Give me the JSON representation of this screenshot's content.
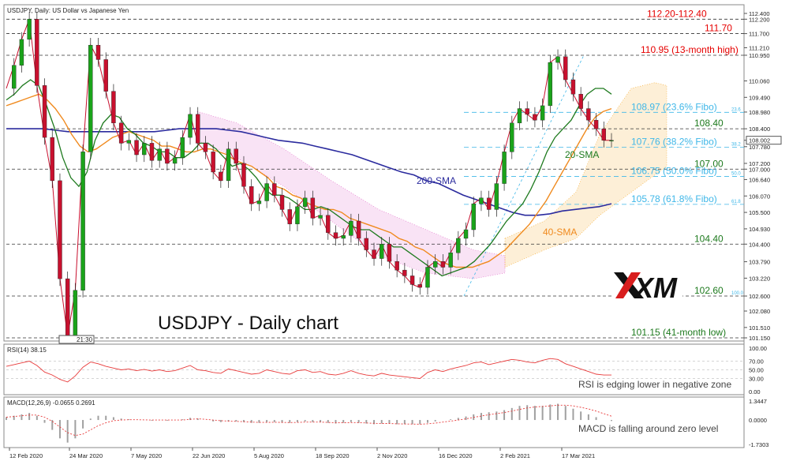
{
  "chart_data": {
    "type": "line",
    "title": "USDJPY - Daily chart",
    "header": "USDJPY, Daily:  US Dollar vs Japanese Yen",
    "brand": "XM",
    "colors": {
      "sma20": "#1e7a1e",
      "sma40": "#f08a1e",
      "sma200": "#2b2b9e",
      "price": "#c8102e",
      "tenkan": "#d05050",
      "kijun": "#5050d8",
      "chikou": "#33cc33",
      "cloud_bull": "#f5a623",
      "cloud_bear": "#e066c6",
      "fibo": "#3fb7e8",
      "level_red": "#e60000",
      "level_green": "#1e7a1e",
      "rsi": "#e83a3a",
      "macd_signal": "#e83a3a",
      "macd_hist": "#a0a0a0"
    },
    "price_axis": {
      "ylim": [
        101.15,
        112.4
      ],
      "ticks": [
        "112.400",
        "112.200",
        "111.700",
        "111.210",
        "110.950",
        "110.060",
        "109.490",
        "108.980",
        "108.400",
        "108.002",
        "107.780",
        "107.200",
        "107.000",
        "106.640",
        "106.070",
        "105.500",
        "104.930",
        "104.400",
        "103.790",
        "103.220",
        "102.600",
        "102.080",
        "101.510",
        "101.150"
      ]
    },
    "x_ticks": [
      "12 Feb 2020",
      "24 Mar 2020",
      "7 May 2020",
      "22 Jun 2020",
      "5 Aug 2020",
      "18 Sep 2020",
      "2 Nov 2020",
      "16 Dec 2020",
      "2 Feb 2021",
      "17 Mar 2021"
    ],
    "series": [
      {
        "name": "price",
        "x": [
          0,
          5,
          10,
          15,
          20,
          25,
          30,
          35,
          40,
          45,
          50,
          55,
          60,
          65,
          70,
          75,
          80,
          85,
          90,
          95,
          100,
          105,
          110,
          115,
          120,
          125,
          130,
          135,
          140,
          145,
          150,
          155,
          160,
          165,
          170,
          175,
          180,
          185,
          190,
          195,
          200,
          205,
          210,
          215,
          220,
          225,
          230,
          235,
          240,
          245,
          250,
          255,
          260,
          265,
          270,
          275,
          280,
          285,
          290,
          295,
          300,
          305,
          310,
          315,
          320,
          325,
          330,
          335,
          340,
          345,
          350,
          355,
          360,
          365,
          370,
          375,
          380,
          385,
          390,
          395,
          400,
          405,
          410,
          415,
          420,
          425,
          430
        ],
        "values": [
          109.8,
          110.6,
          111.5,
          112.2,
          109.9,
          108.1,
          106.6,
          103.2,
          101.2,
          102.8,
          107.6,
          111.3,
          110.8,
          109.7,
          108.6,
          107.9,
          108.0,
          107.5,
          107.9,
          107.3,
          107.7,
          107.2,
          107.4,
          108.1,
          108.9,
          107.9,
          107.6,
          106.9,
          106.6,
          107.7,
          107.2,
          106.4,
          105.8,
          105.9,
          106.5,
          106.1,
          105.6,
          105.1,
          105.7,
          106.0,
          105.3,
          105.4,
          104.8,
          104.6,
          104.7,
          105.2,
          104.6,
          104.2,
          103.9,
          104.4,
          103.8,
          103.5,
          103.3,
          103.0,
          102.9,
          103.6,
          103.8,
          103.6,
          104.1,
          104.6,
          104.9,
          105.8,
          106.0,
          105.6,
          106.5,
          107.6,
          108.6,
          109.1,
          108.9,
          108.7,
          109.2,
          110.7,
          110.9,
          110.1,
          109.6,
          109.1,
          108.7,
          108.4,
          108.0,
          108.0,
          108.0,
          108.0,
          108.0,
          108.0,
          108.0,
          108.0,
          108.0
        ]
      },
      {
        "name": "20-SMA",
        "values": [
          109.4,
          109.6,
          109.9,
          110.1,
          109.9,
          109.2,
          108.4,
          107.4,
          106.7,
          106.4,
          106.9,
          108.0,
          108.6,
          108.9,
          108.8,
          108.4,
          108.2,
          107.9,
          107.8,
          107.6,
          107.6,
          107.4,
          107.4,
          107.6,
          107.9,
          107.9,
          107.7,
          107.4,
          107.1,
          107.2,
          107.0,
          106.7,
          106.3,
          106.1,
          106.1,
          106.0,
          105.8,
          105.6,
          105.6,
          105.7,
          105.6,
          105.4,
          105.2,
          105.0,
          104.9,
          104.9,
          104.7,
          104.5,
          104.3,
          104.3,
          104.1,
          103.9,
          103.7,
          103.5,
          103.3,
          103.4,
          103.5,
          103.6,
          103.8,
          104.1,
          104.4,
          104.8,
          105.2,
          105.5,
          105.8,
          106.3,
          106.9,
          107.6,
          108.1,
          108.4,
          108.7,
          109.2,
          109.6,
          109.8,
          109.8,
          109.6
        ]
      },
      {
        "name": "40-SMA",
        "values": [
          109.2,
          109.3,
          109.4,
          109.5,
          109.6,
          109.4,
          109.1,
          108.7,
          108.2,
          107.8,
          107.6,
          107.7,
          107.9,
          108.1,
          108.2,
          108.3,
          108.2,
          108.1,
          108.0,
          107.8,
          107.8,
          107.7,
          107.6,
          107.6,
          107.7,
          107.7,
          107.6,
          107.5,
          107.3,
          107.2,
          107.1,
          106.9,
          106.7,
          106.4,
          106.3,
          106.1,
          106.0,
          105.8,
          105.7,
          105.6,
          105.6,
          105.5,
          105.3,
          105.2,
          105.1,
          105.0,
          104.9,
          104.8,
          104.6,
          104.5,
          104.3,
          104.2,
          104.0,
          103.8,
          103.7,
          103.6,
          103.6,
          103.6,
          103.7,
          103.8,
          104.0,
          104.2,
          104.5,
          104.8,
          105.1,
          105.5,
          105.9,
          106.4,
          106.9,
          107.4,
          107.9,
          108.4,
          108.8,
          109.0,
          109.1
        ]
      },
      {
        "name": "200-SMA",
        "values": [
          108.4,
          108.4,
          108.4,
          108.4,
          108.35,
          108.3,
          108.3,
          108.3,
          108.3,
          108.3,
          108.3,
          108.3,
          108.3,
          108.35,
          108.4,
          108.4,
          108.4,
          108.4,
          108.35,
          108.3,
          108.2,
          108.1,
          108.0,
          107.95,
          107.9,
          107.8,
          107.7,
          107.6,
          107.5,
          107.35,
          107.2,
          107.05,
          106.9,
          106.8,
          106.6,
          106.5,
          106.3,
          106.1,
          105.95,
          105.8,
          105.65,
          105.5,
          105.4,
          105.4,
          105.45,
          105.55,
          105.6,
          105.65,
          105.7,
          105.8
        ]
      }
    ],
    "levels": [
      {
        "value": 112.2,
        "label": "112.20-112.40",
        "color": "red"
      },
      {
        "value": 111.7,
        "label": "111.70",
        "color": "red"
      },
      {
        "value": 110.95,
        "label": "110.95 (13-month high)",
        "color": "red"
      },
      {
        "value": 108.97,
        "label": "108.97 (23.6% Fibo)",
        "color": "fibo"
      },
      {
        "value": 108.4,
        "label": "108.40",
        "color": "green"
      },
      {
        "value": 107.76,
        "label": "107.76 (38.2% Fibo)",
        "color": "fibo"
      },
      {
        "value": 107.0,
        "label": "107.00",
        "color": "green"
      },
      {
        "value": 106.75,
        "label": "106.75 (50.0% Fibo)",
        "color": "fibo"
      },
      {
        "value": 105.78,
        "label": "105.78 (61.8% Fibo)",
        "color": "fibo"
      },
      {
        "value": 104.4,
        "label": "104.40",
        "color": "green"
      },
      {
        "value": 102.6,
        "label": "102.60",
        "color": "green"
      },
      {
        "value": 101.15,
        "label": "101.15 (41-month low)",
        "color": "green"
      }
    ],
    "fibo_markers": [
      "23.6",
      "38.2",
      "50.0",
      "61.8",
      "100.0"
    ],
    "annotations": [
      {
        "text": "200-SMA",
        "color": "sma200"
      },
      {
        "text": "20-SMA",
        "color": "sma20"
      },
      {
        "text": "40-SMA",
        "color": "sma40"
      }
    ],
    "misc_label": "21:30",
    "rsi": {
      "label": "RSI(14) 38.15",
      "ylim": [
        0,
        100
      ],
      "ticks": [
        "100.00",
        "70.00",
        "50.00",
        "30.00",
        "0.00"
      ],
      "note": "RSI is edging lower in negative zone",
      "values": [
        58,
        62,
        66,
        70,
        60,
        45,
        38,
        28,
        22,
        36,
        56,
        68,
        64,
        58,
        54,
        50,
        52,
        48,
        51,
        47,
        50,
        46,
        48,
        54,
        60,
        50,
        48,
        44,
        42,
        52,
        48,
        44,
        40,
        42,
        50,
        46,
        42,
        40,
        48,
        50,
        44,
        46,
        40,
        38,
        42,
        48,
        42,
        38,
        36,
        42,
        38,
        36,
        34,
        32,
        30,
        44,
        50,
        46,
        52,
        56,
        60,
        66,
        68,
        62,
        66,
        70,
        74,
        72,
        68,
        66,
        72,
        76,
        74,
        64,
        58,
        52,
        46,
        40,
        38,
        38
      ]
    },
    "macd": {
      "label": "MACD(12,26,9) -0.0655 0.2691",
      "ylim": [
        -1.7303,
        1.3447
      ],
      "ticks": [
        "1.3447",
        "0.0000",
        "-1.7303"
      ],
      "note": "MACD is falling around zero level",
      "hist": [
        0.2,
        0.3,
        0.4,
        0.5,
        0.3,
        -0.2,
        -0.7,
        -1.3,
        -1.6,
        -1.3,
        -0.6,
        0.1,
        0.3,
        0.3,
        0.2,
        0.1,
        0.05,
        0.0,
        0.0,
        -0.05,
        0.0,
        -0.05,
        0.0,
        0.05,
        0.15,
        0.1,
        0.0,
        -0.1,
        -0.15,
        -0.1,
        -0.1,
        -0.15,
        -0.2,
        -0.2,
        -0.15,
        -0.15,
        -0.2,
        -0.2,
        -0.15,
        -0.1,
        -0.15,
        -0.15,
        -0.2,
        -0.25,
        -0.2,
        -0.15,
        -0.2,
        -0.25,
        -0.3,
        -0.25,
        -0.25,
        -0.3,
        -0.3,
        -0.3,
        -0.3,
        -0.2,
        -0.1,
        0.0,
        0.05,
        0.15,
        0.25,
        0.4,
        0.5,
        0.55,
        0.6,
        0.7,
        0.85,
        1.0,
        1.05,
        1.0,
        1.0,
        1.1,
        1.15,
        1.0,
        0.8,
        0.6,
        0.4,
        0.2,
        0.0,
        -0.07
      ],
      "signal": [
        0.2,
        0.25,
        0.3,
        0.35,
        0.35,
        0.2,
        -0.1,
        -0.5,
        -0.9,
        -1.1,
        -1.0,
        -0.7,
        -0.4,
        -0.2,
        -0.05,
        0.0,
        0.02,
        0.02,
        0.01,
        0.0,
        0.0,
        0.0,
        0.0,
        0.0,
        0.05,
        0.08,
        0.05,
        0.0,
        -0.05,
        -0.08,
        -0.1,
        -0.12,
        -0.15,
        -0.17,
        -0.17,
        -0.16,
        -0.17,
        -0.18,
        -0.17,
        -0.15,
        -0.15,
        -0.15,
        -0.17,
        -0.2,
        -0.2,
        -0.18,
        -0.19,
        -0.21,
        -0.24,
        -0.25,
        -0.25,
        -0.27,
        -0.28,
        -0.29,
        -0.3,
        -0.27,
        -0.22,
        -0.15,
        -0.08,
        0.0,
        0.08,
        0.18,
        0.28,
        0.37,
        0.45,
        0.53,
        0.63,
        0.75,
        0.85,
        0.92,
        0.96,
        1.0,
        1.05,
        1.05,
        1.0,
        0.9,
        0.78,
        0.63,
        0.45,
        0.27
      ]
    }
  }
}
